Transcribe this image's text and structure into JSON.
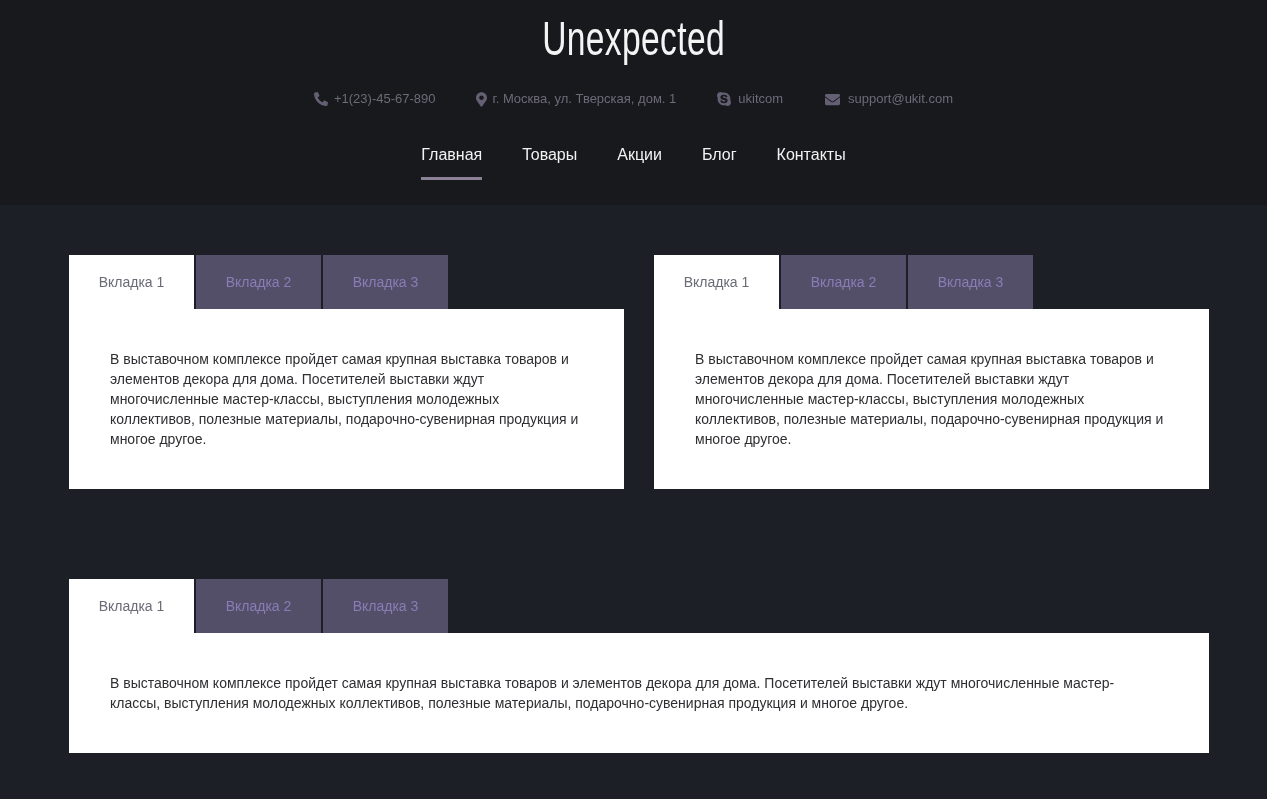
{
  "header": {
    "title": "Unexpected",
    "contacts": [
      {
        "kind": "phone",
        "text": "+1(23)-45-67-890"
      },
      {
        "kind": "location",
        "text": "г. Москва, ул. Тверская, дом. 1"
      },
      {
        "kind": "skype",
        "text": "ukitcom"
      },
      {
        "kind": "email",
        "text": "support@ukit.com"
      }
    ],
    "nav": [
      {
        "label": "Главная",
        "selected": true
      },
      {
        "label": "Товары",
        "selected": false
      },
      {
        "label": "Акции",
        "selected": false
      },
      {
        "label": "Блог",
        "selected": false
      },
      {
        "label": "Контакты",
        "selected": false
      }
    ]
  },
  "rows": [
    {
      "widgets": [
        {
          "tabs": [
            {
              "label": "Вкладка 1",
              "selected": true
            },
            {
              "label": "Вкладка 2",
              "selected": false
            },
            {
              "label": "Вкладка 3",
              "selected": false
            }
          ],
          "content": "В выставочном комплексе пройдет самая крупная выставка товаров и элементов декора для дома. Посетителей выставки ждут многочисленные мастер-классы, выступления молодежных коллективов, полезные материалы, подарочно-сувенирная продукция и многое другое."
        },
        {
          "tabs": [
            {
              "label": "Вкладка 1",
              "selected": true
            },
            {
              "label": "Вкладка 2",
              "selected": false
            },
            {
              "label": "Вкладка 3",
              "selected": false
            }
          ],
          "content": "В выставочном комплексе пройдет самая крупная выставка товаров и элементов декора для дома. Посетителей выставки ждут многочисленные мастер-классы, выступления молодежных коллективов, полезные материалы, подарочно-сувенирная продукция и многое другое."
        }
      ]
    },
    {
      "widgets": [
        {
          "tabs": [
            {
              "label": "Вкладка 1",
              "selected": true
            },
            {
              "label": "Вкладка 2",
              "selected": false
            },
            {
              "label": "Вкладка 3",
              "selected": false
            }
          ],
          "content": "В выставочном комплексе пройдет самая крупная выставка товаров и элементов декора для дома. Посетителей выставки ждут многочисленные мастер-классы, выступления молодежных коллективов, полезные материалы, подарочно-сувенирная продукция и многое другое."
        }
      ]
    }
  ]
}
